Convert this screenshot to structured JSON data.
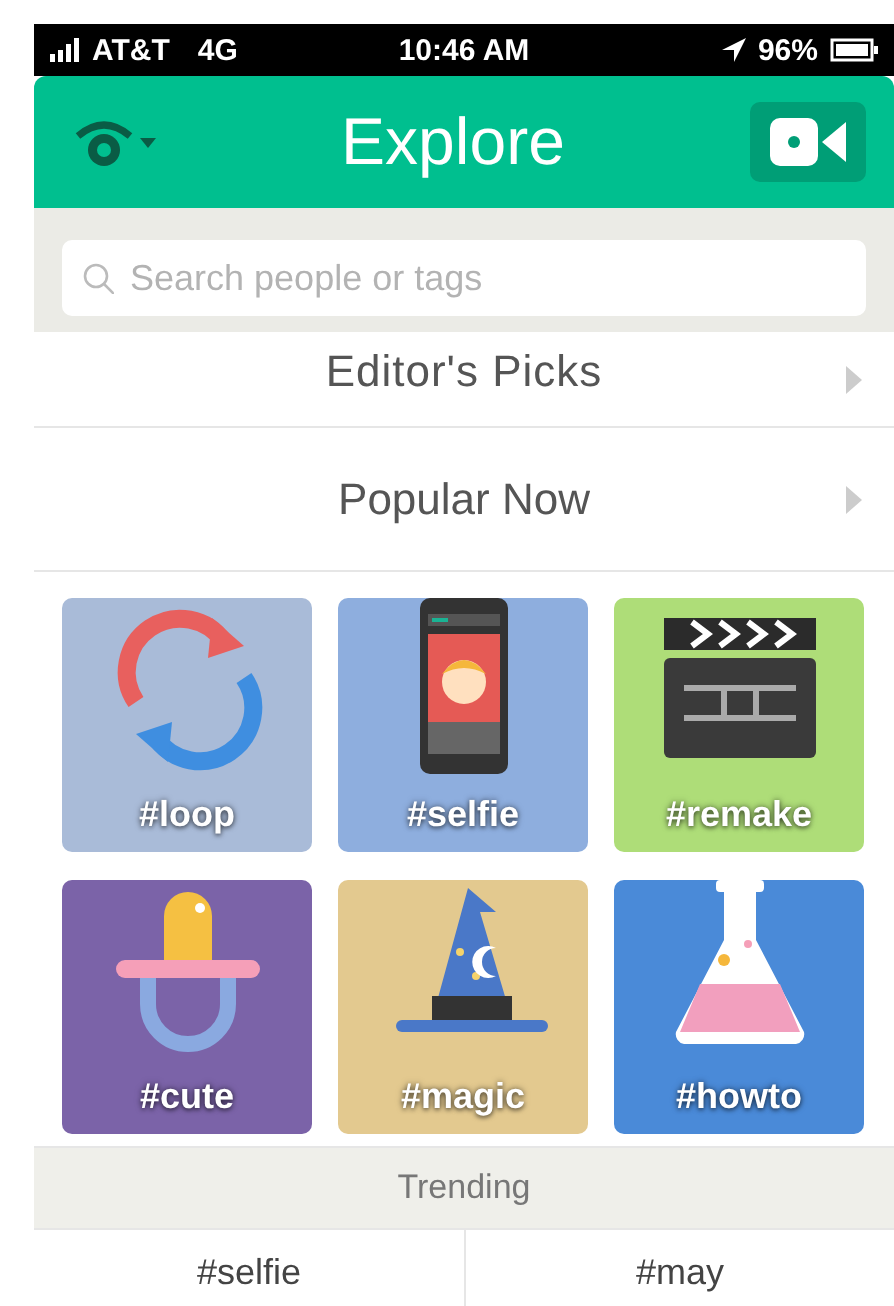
{
  "status_bar": {
    "carrier": "AT&T",
    "network": "4G",
    "time": "10:46 AM",
    "battery": "96%"
  },
  "header": {
    "title": "Explore"
  },
  "search": {
    "placeholder": "Search people or tags"
  },
  "nav_rows": [
    {
      "label": "Editor's Picks"
    },
    {
      "label": "Popular Now"
    }
  ],
  "tiles": [
    {
      "label": "#loop",
      "kind": "loop",
      "color": "#a9bbd8"
    },
    {
      "label": "#selfie",
      "kind": "phone",
      "color": "#8eaede"
    },
    {
      "label": "#remake",
      "kind": "clapper",
      "color": "#aedd78"
    },
    {
      "label": "#cute",
      "kind": "pacifier",
      "color": "#7b63a8"
    },
    {
      "label": "#magic",
      "kind": "hat",
      "color": "#e3c98f"
    },
    {
      "label": "#howto",
      "kind": "flask",
      "color": "#4a8ad8"
    }
  ],
  "trending": {
    "title": "Trending",
    "items": [
      "#selfie",
      "#may"
    ]
  }
}
